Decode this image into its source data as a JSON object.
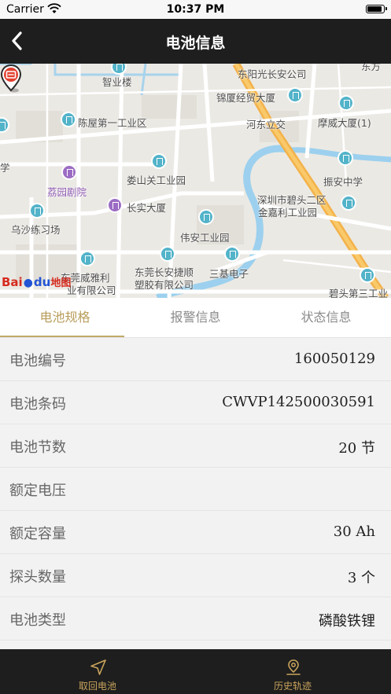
{
  "status_bar": {
    "carrier": "Carrier",
    "time": "10:37 PM"
  },
  "nav": {
    "title": "电池信息"
  },
  "map": {
    "labels": [
      "智业楼",
      "东阳光长安公司",
      "锦厦经贸大厦",
      "陈屋第一工业区",
      "河东立交",
      "摩威大厦(1)",
      "学",
      "荔园剧院",
      "娄山关工业园",
      "振安中学",
      "深圳市碧头二区",
      "金嘉利工业园",
      "长实大厦",
      "乌沙练习场",
      "伟安工业园",
      "东莞威雅利",
      "业有限公司",
      "东莞长安捷顺",
      "塑胶有限公司",
      "三基电子",
      "碧头第三工业",
      "东方"
    ],
    "logo": {
      "bai": "Bai",
      "du": "du",
      "ditu": "地图"
    }
  },
  "tabs": [
    {
      "label": "电池规格",
      "active": true
    },
    {
      "label": "报警信息",
      "active": false
    },
    {
      "label": "状态信息",
      "active": false
    }
  ],
  "rows": [
    {
      "label": "电池编号",
      "value": "160050129"
    },
    {
      "label": "电池条码",
      "value": "CWVP142500030591"
    },
    {
      "label": "电池节数",
      "value": "20 节"
    },
    {
      "label": "额定电压",
      "value": ""
    },
    {
      "label": "额定容量",
      "value": "30 Ah"
    },
    {
      "label": "探头数量",
      "value": "3 个"
    },
    {
      "label": "电池类型",
      "value": "磷酸铁锂"
    }
  ],
  "tabbar": [
    {
      "label": "取回电池",
      "icon": "navigation-arrow-icon"
    },
    {
      "label": "历史轨迹",
      "icon": "location-pin-icon"
    }
  ],
  "colors": {
    "accent": "#c2a86a",
    "bar": "#1e1e1e",
    "tabbar_text": "#c9a45c"
  }
}
